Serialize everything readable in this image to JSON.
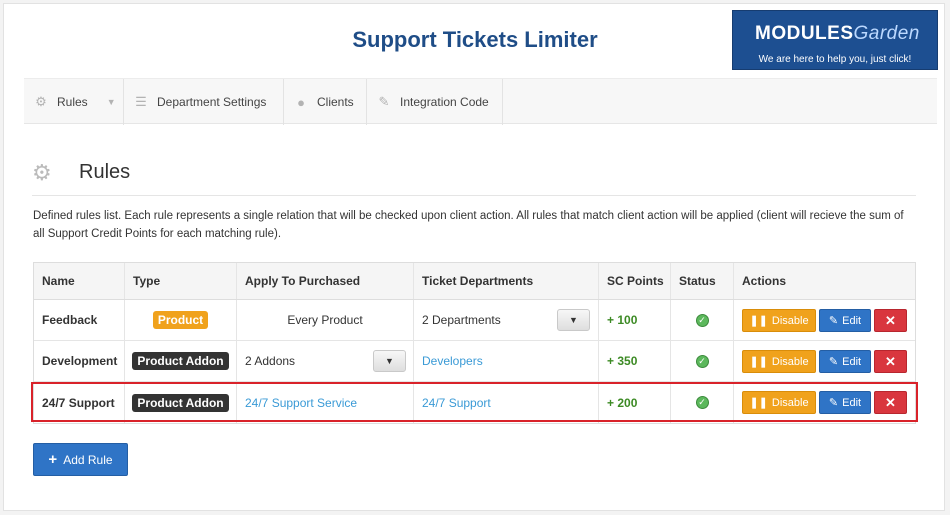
{
  "header": {
    "title": "Support Tickets Limiter",
    "logo_text": "MODULES",
    "logo_text_2": "Garden",
    "logo_tagline": "We are here to help you, just click!"
  },
  "nav": [
    {
      "label": "Rules",
      "icon": "gear-icon"
    },
    {
      "label": "Department Settings",
      "icon": "list-icon"
    },
    {
      "label": "Clients",
      "icon": "user-icon"
    },
    {
      "label": "Integration Code",
      "icon": "edit-icon"
    }
  ],
  "section": {
    "title": "Rules",
    "description": "Defined rules list. Each rule represents a single relation that will be checked upon client action. All rules that match client action will be applied (client will recieve the sum of all Support Credit Points for each matching rule)."
  },
  "table": {
    "headers": [
      "Name",
      "Type",
      "Apply To Purchased",
      "Ticket Departments",
      "SC Points",
      "Status",
      "Actions"
    ],
    "rows": [
      {
        "name": "Feedback",
        "type": "Product",
        "apply": "Every Product",
        "departments": "2 Departments",
        "points": "+ 100"
      },
      {
        "name": "Development",
        "type": "Product Addon",
        "apply": "2 Addons",
        "departments": "Developers",
        "points": "+ 350"
      },
      {
        "name": "24/7 Support",
        "type": "Product Addon",
        "apply": "24/7 Support Service",
        "departments": "24/7 Support",
        "points": "+ 200"
      }
    ],
    "disable_label": "Disable",
    "edit_label": "Edit",
    "delete_label": "✕"
  },
  "add_rule_label": "Add Rule",
  "colors": {
    "brand": "#1f4d87",
    "orange": "#f0a21c",
    "blue": "#2f74c6",
    "red": "#d9363e",
    "green": "#3c8a24",
    "highlight": "#d9222a"
  }
}
